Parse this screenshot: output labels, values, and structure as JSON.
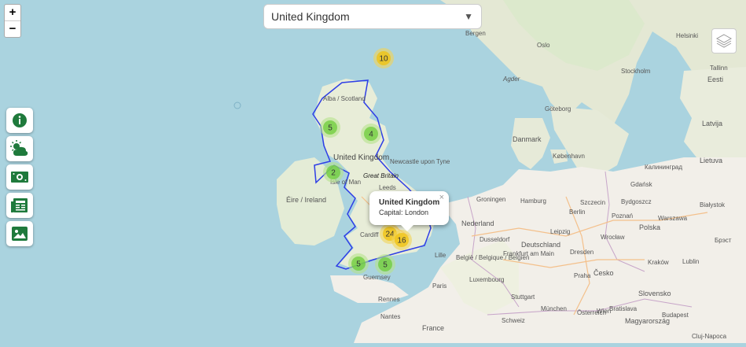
{
  "selector": {
    "value": "United Kingdom"
  },
  "zoom": {
    "in": "+",
    "out": "−"
  },
  "popup": {
    "title": "United Kingdom",
    "capital": "Capital: London",
    "close": "×"
  },
  "clusters": [
    {
      "count": "10",
      "color": "yellow"
    },
    {
      "count": "5",
      "color": "green"
    },
    {
      "count": "4",
      "color": "green"
    },
    {
      "count": "2",
      "color": "green"
    },
    {
      "count": "24",
      "color": "yellow"
    },
    {
      "count": "16",
      "color": "yellow"
    },
    {
      "count": "5",
      "color": "green"
    },
    {
      "count": "5",
      "color": "green"
    }
  ],
  "labels": {
    "uk": "United Kingdom",
    "gb": "Great Britain",
    "ireland": "Éire / Ireland",
    "man": "Isle of Man",
    "scotland": "Alba / Scotland",
    "newcastle": "Newcastle upon Tyne",
    "leeds": "Leeds",
    "cardiff": "Cardiff",
    "guernsey": "Guernsey",
    "bergen": "Bergen",
    "oslo": "Oslo",
    "stockholm": "Stockholm",
    "tallinn": "Tallinn",
    "eesti": "Eesti",
    "latvija": "Latvija",
    "lietuva": "Lietuva",
    "danmark": "Danmark",
    "kobenhavn": "København",
    "goteborg": "Göteborg",
    "hamburg": "Hamburg",
    "berlin": "Berlin",
    "groningen": "Groningen",
    "nederland": "Nederland",
    "dusseldorf": "Dusseldorf",
    "frankfurt": "Frankfurt am Main",
    "deutschland": "Deutschland",
    "belgie": "België / Belgique / Belgien",
    "luxembourg": "Luxembourg",
    "paris": "Paris",
    "rennes": "Rennes",
    "nantes": "Nantes",
    "france": "France",
    "lille": "Lille",
    "stuttgart": "Stuttgart",
    "munchen": "München",
    "schweiz": "Schweiz",
    "osterreich": "Österreich",
    "praha": "Praha",
    "cesko": "Česko",
    "dresden": "Dresden",
    "leipzig": "Leipzig",
    "polska": "Polska",
    "warszawa": "Warszawa",
    "krakow": "Kraków",
    "poznan": "Poznań",
    "wroclaw": "Wrocław",
    "gdansk": "Gdańsk",
    "bydgoszcz": "Bydgoszcz",
    "szczecin": "Szczecin",
    "bialystok": "Białystok",
    "kaliningrad": "Калининград",
    "brest": "Брэст",
    "slovensko": "Slovensko",
    "bratislava": "Bratislava",
    "budapest": "Budapest",
    "magyarorszag": "Magyarország",
    "wien": "Wien",
    "cluj": "Cluj-Napoca",
    "lublin": "Lublin",
    "agder": "Agder",
    "helsinki": "Helsinki"
  }
}
